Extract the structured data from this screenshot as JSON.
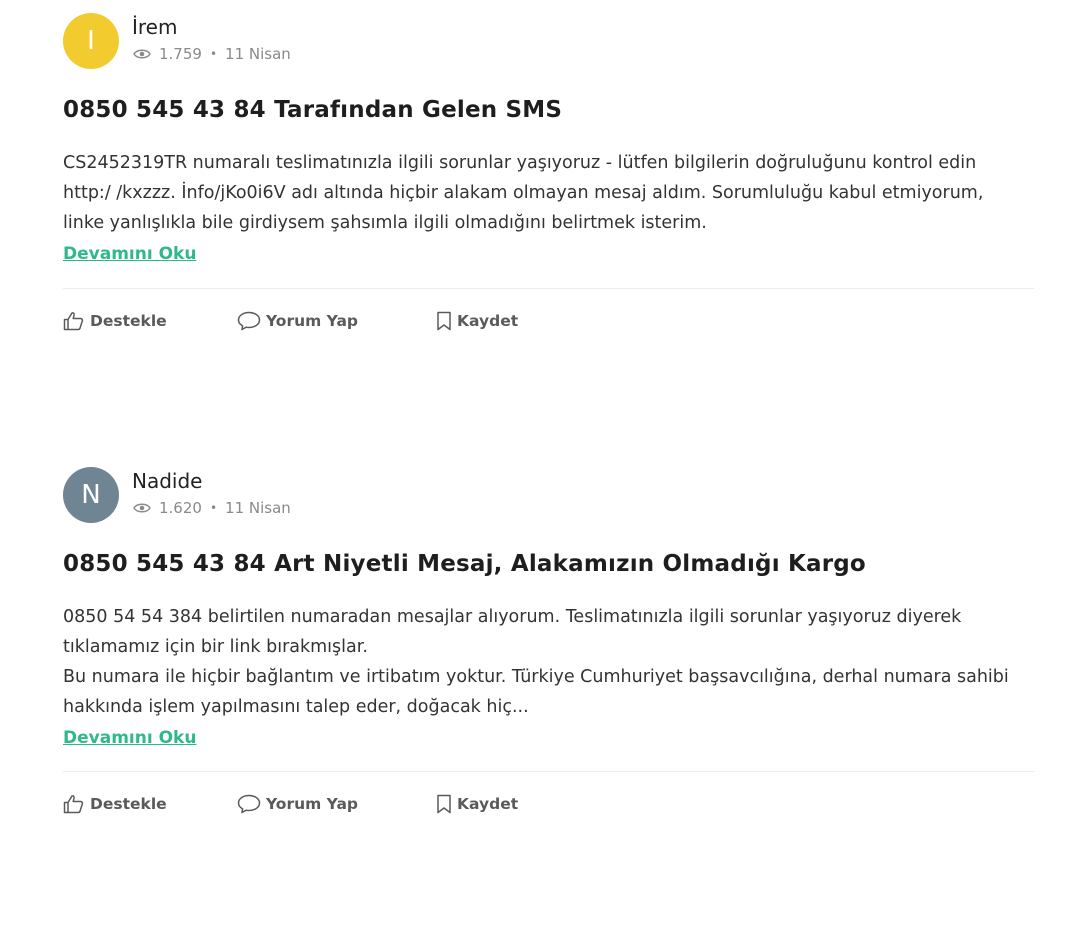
{
  "posts": [
    {
      "avatar_letter": "I",
      "avatar_color": "#f2cb2f",
      "author": "İrem",
      "views": "1.759",
      "separator": "•",
      "date": "11 Nisan",
      "title": "0850 545 43 84 Tarafından Gelen SMS",
      "body": [
        "CS2452319TR numaralı teslimatınızla ilgili sorunlar yaşıyoruz - lütfen bilgilerin doğruluğunu kontrol edin http:/ /kxzzz. İnfo/jKo0i6V adı altında hiçbir alakam olmayan mesaj aldım. Sorumluluğu kabul etmiyorum, linke yanlışlıkla bile girdiysem şahsımla ilgili olmadığını belirtmek isterim."
      ],
      "read_more": "Devamını Oku",
      "actions": {
        "support": "Destekle",
        "comment": "Yorum Yap",
        "save": "Kaydet"
      }
    },
    {
      "avatar_letter": "N",
      "avatar_color": "#6f8594",
      "author": "Nadide",
      "views": "1.620",
      "separator": "•",
      "date": "11 Nisan",
      "title": "0850 545 43 84 Art Niyetli Mesaj, Alakamızın Olmadığı Kargo",
      "body": [
        "0850 54 54 384 belirtilen numaradan mesajlar alıyorum. Teslimatınızla ilgili sorunlar yaşıyoruz diyerek tıklamamız için bir link bırakmışlar.",
        "Bu numara ile hiçbir bağlantım ve irtibatım yoktur. Türkiye Cumhuriyet başsavcılığına, derhal numara sahibi hakkında işlem yapılmasını talep eder, doğacak hiç..."
      ],
      "read_more": "Devamını Oku",
      "actions": {
        "support": "Destekle",
        "comment": "Yorum Yap",
        "save": "Kaydet"
      }
    }
  ],
  "colors": {
    "link_green": "#2fb98b",
    "muted_text": "#8a8a8a",
    "action_text": "#5a5a5a"
  },
  "icons": {
    "views": "eye-icon",
    "support": "thumbs-up-icon",
    "comment": "speech-bubble-icon",
    "save": "bookmark-icon"
  }
}
